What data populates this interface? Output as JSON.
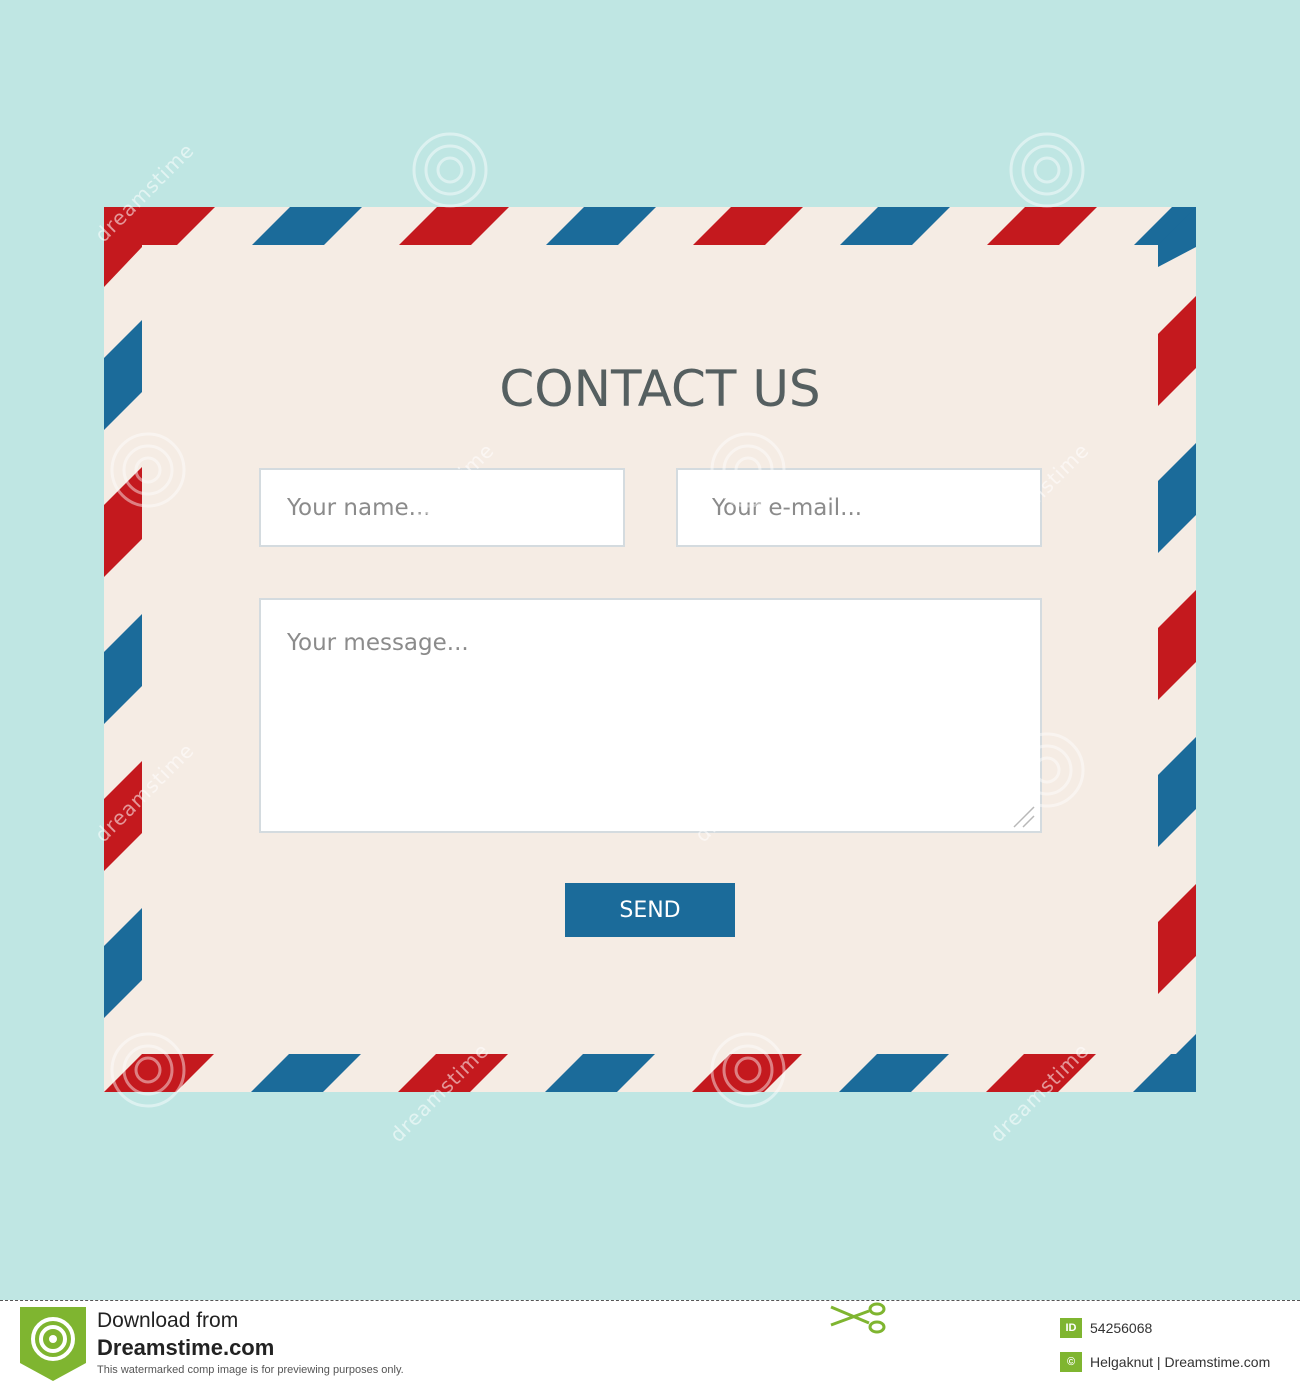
{
  "colors": {
    "background": "#bfe6e3",
    "envelope": "#f5ece4",
    "stripe_red": "#c4191e",
    "stripe_blue": "#1b6b9a",
    "title": "#555f60",
    "button": "#1b6b9a"
  },
  "form": {
    "title": "CONTACT US",
    "name_placeholder": "Your name...",
    "email_placeholder": "Your e-mail...",
    "message_placeholder": "Your message...",
    "send_label": "SEND"
  },
  "watermark": {
    "text": "dreamstime"
  },
  "footer": {
    "download_line1": "Download from",
    "download_line2": "Dreamstime.com",
    "note": "This watermarked comp image is for previewing purposes only.",
    "id_badge": "ID",
    "id_value": "54256068",
    "copyright_badge": "©",
    "credit": "Helgaknut | Dreamstime.com",
    "icons": [
      "dreamstime-logo-icon",
      "scissors-icon"
    ]
  }
}
